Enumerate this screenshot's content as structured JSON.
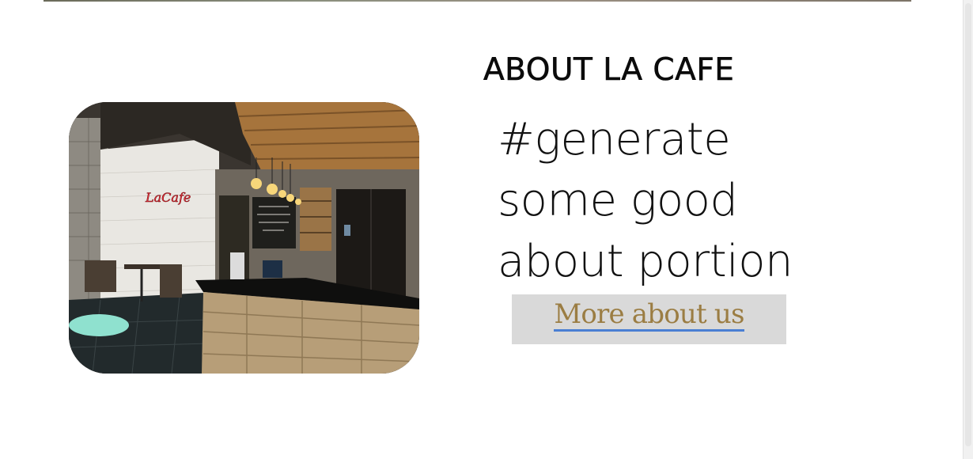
{
  "about": {
    "heading": "ABOUT LA CAFE",
    "body": "#generate\nsome good\nabout portion",
    "button_label": "More about us"
  },
  "photo": {
    "sign_text": "LaCafe",
    "description_icon": "cafe-interior-photo"
  },
  "colors": {
    "button_bg": "#d9d9d9",
    "button_text": "#9b7d43",
    "link_underline": "#4a7fd3"
  }
}
